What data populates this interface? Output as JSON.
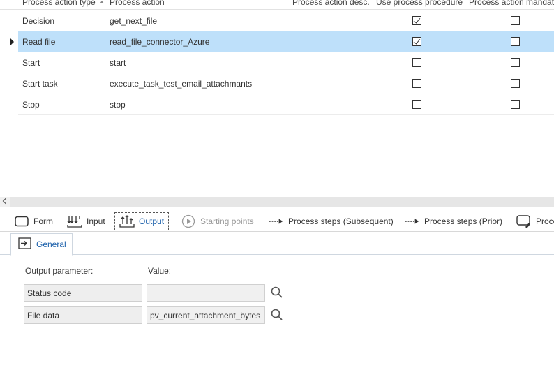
{
  "grid": {
    "columns": [
      "Process action type",
      "Process action",
      "Process action desc.",
      "Use process procedure",
      "Process action mandato"
    ],
    "rows": [
      {
        "type": "Decision",
        "action": "get_next_file",
        "desc": "",
        "use_procedure": true,
        "mandatory": false
      },
      {
        "type": "Read file",
        "action": "read_file_connector_Azure",
        "desc": "",
        "use_procedure": true,
        "mandatory": false
      },
      {
        "type": "Start",
        "action": "start",
        "desc": "",
        "use_procedure": false,
        "mandatory": false
      },
      {
        "type": "Start task",
        "action": "execute_task_test_email_attachmants",
        "desc": "",
        "use_procedure": false,
        "mandatory": false
      },
      {
        "type": "Stop",
        "action": "stop",
        "desc": "",
        "use_procedure": false,
        "mandatory": false
      }
    ],
    "selected_row": 1
  },
  "toolbar": {
    "form": "Form",
    "input": "Input",
    "output": "Output",
    "starting_points": "Starting points",
    "steps_subsequent": "Process steps (Subsequent)",
    "steps_prior": "Process steps (Prior)",
    "proc_truncated": "Proce"
  },
  "detail": {
    "tab_general": "General",
    "output_parameter_label": "Output parameter:",
    "value_label": "Value:",
    "params": [
      {
        "name": "Status code",
        "value": ""
      },
      {
        "name": "File data",
        "value": "pv_current_attachment_bytes"
      }
    ]
  },
  "colors": {
    "selected_row": "#bee0fa",
    "accent": "#1a5faa"
  }
}
